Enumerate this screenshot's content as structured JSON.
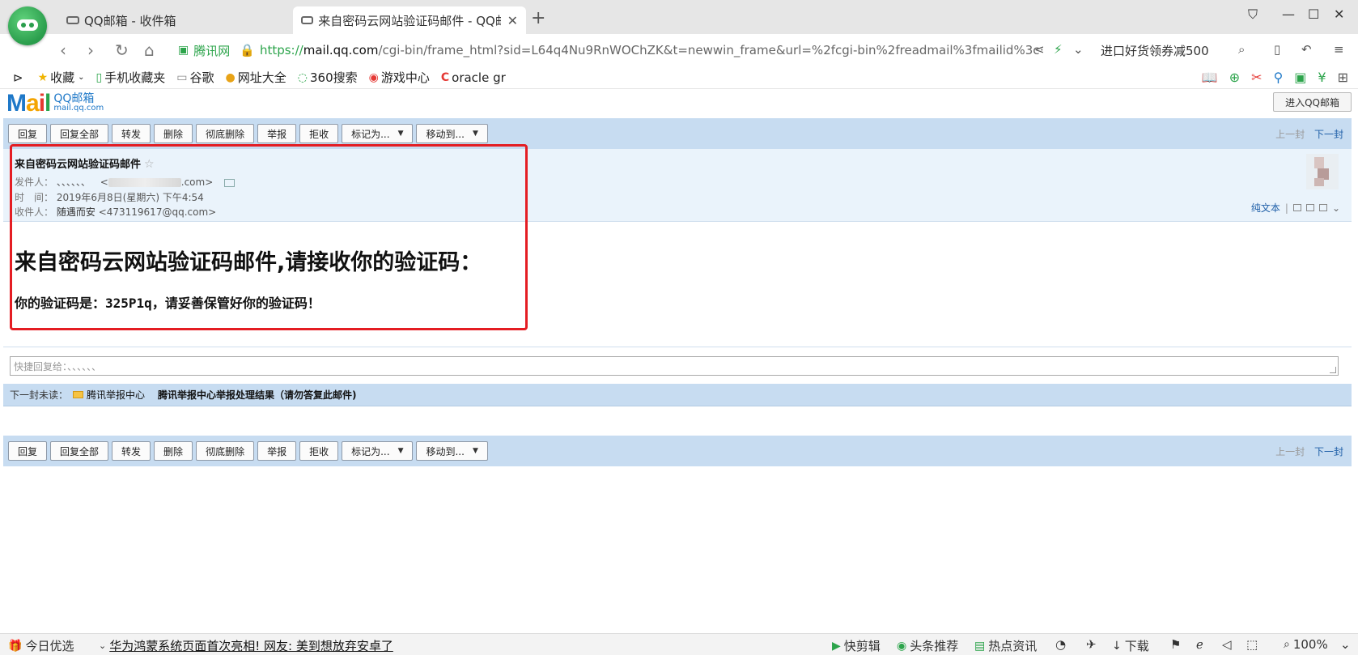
{
  "browser": {
    "tabs": [
      {
        "title": "QQ邮箱 - 收件箱"
      },
      {
        "title": "来自密码云网站验证码邮件 - QQ邮",
        "close": "✕"
      }
    ],
    "new_tab": "+",
    "address": {
      "site_label": "腾讯网",
      "scheme": "https://",
      "host": "mail.qq.com",
      "path": "/cgi-bin/frame_html?sid=L64q4Nu9RnWOChZK&t=newwin_frame&url=%2fcgi-bin%2freadmail%3fmailid%3c"
    },
    "search_promo": "进口好货领券减500",
    "bookmarks": [
      {
        "label": "收藏",
        "icon": "star-icon"
      },
      {
        "label": "手机收藏夹",
        "icon": "phone-icon"
      },
      {
        "label": "谷歌",
        "icon": "page-icon"
      },
      {
        "label": "网址大全",
        "icon": "globe-icon"
      },
      {
        "label": "360搜索",
        "icon": "search-360-icon"
      },
      {
        "label": "游戏中心",
        "icon": "game-icon"
      },
      {
        "label": "oracle gr",
        "icon": "oracle-icon"
      }
    ]
  },
  "mail": {
    "logo": {
      "letters": [
        "M",
        "a",
        "i",
        "l"
      ],
      "cn": "QQ邮箱",
      "domain": "mail.qq.com"
    },
    "enter_button": "进入QQ邮箱",
    "toolbar": {
      "buttons": [
        "回复",
        "回复全部",
        "转发",
        "删除",
        "彻底删除",
        "举报",
        "拒收"
      ],
      "mark_as": "标记为...",
      "move_to": "移动到...",
      "prev": "上一封",
      "next": "下一封"
    },
    "header": {
      "subject": "来自密码云网站验证码邮件",
      "from_label": "发件人：",
      "from_name": "、、、、、、",
      "from_email_suffix": ".com>",
      "time_label": "时　间：",
      "time": "2019年6月8日(星期六) 下午4:54",
      "to_label": "收件人：",
      "to_name": "随遇而安",
      "to_email": "<473119617@qq.com>",
      "plain_text": "纯文本"
    },
    "body": {
      "heading": "来自密码云网站验证码邮件,请接收你的验证码：",
      "prefix": "你的验证码是：",
      "code": "325P1q",
      "suffix": "，请妥善保管好你的验证码！"
    },
    "quick_reply_placeholder": "快捷回复给：、、、、、、",
    "next_unread": {
      "label": "下一封未读：",
      "sender": "腾讯举报中心",
      "subject": "腾讯举报中心举报处理结果（请勿答复此邮件)"
    }
  },
  "statusbar": {
    "today": "今日优选",
    "news": "华为鸿蒙系统页面首次亮相! 网友: 美到想放弃安卓了",
    "clip": "快剪辑",
    "headline": "头条推荐",
    "hot": "热点资讯",
    "download": "下载",
    "zoom": "100%"
  }
}
